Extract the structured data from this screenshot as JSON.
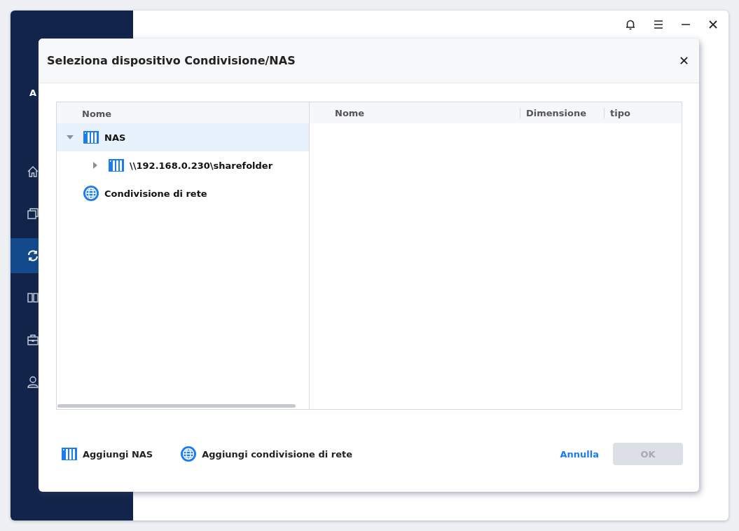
{
  "app": {
    "logo_text": "A",
    "sidebar": [
      {
        "kind": "home",
        "selected": false
      },
      {
        "kind": "copy",
        "selected": false
      },
      {
        "kind": "sync",
        "selected": true
      },
      {
        "kind": "columns",
        "selected": false
      },
      {
        "kind": "toolbox",
        "selected": false
      },
      {
        "kind": "user",
        "selected": false
      }
    ]
  },
  "dialog": {
    "title": "Seleziona dispositivo Condivisione/NAS",
    "tree": {
      "column": "Nome",
      "nodes": [
        {
          "label": "NAS",
          "kind": "nas",
          "expanded": true,
          "selected": true,
          "children": [
            {
              "label": "\\\\192.168.0.230\\sharefolder",
              "kind": "nas",
              "expanded": false,
              "selected": false
            }
          ]
        },
        {
          "label": "Condivisione di rete",
          "kind": "network",
          "selected": false
        }
      ]
    },
    "table": {
      "columns": [
        "Nome",
        "Dimensione",
        "tipo"
      ]
    },
    "actions": [
      {
        "label": "Aggiungi NAS",
        "kind": "nas"
      },
      {
        "label": "Aggiungi condivisione di rete",
        "kind": "network"
      }
    ],
    "cancel": "Annulla",
    "ok": {
      "label": "OK",
      "disabled": true
    }
  }
}
